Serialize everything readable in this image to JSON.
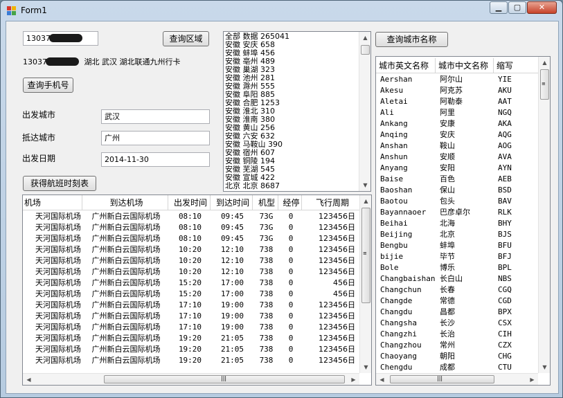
{
  "window": {
    "title": "Form1",
    "minimize_glyph": "▁",
    "maximize_glyph": "▢",
    "close_glyph": "✕",
    "icon_colors": [
      "#d9342b",
      "#f0b400",
      "#3a7bd5",
      "#47a447"
    ]
  },
  "phone": {
    "input_value": "13037",
    "result_prefix": "13037",
    "result_text": "湖北  武汉  湖北联通九州行卡",
    "query_region_button": "查询区域",
    "query_phone_button": "查询手机号"
  },
  "region_list": [
    "全部  数据  265041",
    "安徽  安庆  658",
    "安徽  蚌埠  456",
    "安徽  亳州  489",
    "安徽  巢湖  323",
    "安徽  池州  281",
    "安徽  滁州  555",
    "安徽  阜阳  885",
    "安徽  合肥  1253",
    "安徽  淮北  310",
    "安徽  淮南  380",
    "安徽  黄山  256",
    "安徽  六安  632",
    "安徽  马鞍山  390",
    "安徽  宿州  607",
    "安徽  铜陵  194",
    "安徽  芜湖  545",
    "安徽  宣城  422",
    "北京  北京  8687"
  ],
  "flight_form": {
    "departure_label": "出发城市",
    "departure_value": "武汉",
    "arrival_label": "抵达城市",
    "arrival_value": "广州",
    "date_label": "出发日期",
    "date_value": "2014-11-30",
    "get_schedule_button": "获得航班时刻表"
  },
  "flights": {
    "columns": [
      "机场",
      "到达机场",
      "出发时间",
      "到达时间",
      "机型",
      "经停",
      "飞行周期"
    ],
    "rows": [
      [
        "天河国际机场",
        "广州新白云国际机场",
        "08:10",
        "09:45",
        "73G",
        "0",
        "123456日"
      ],
      [
        "天河国际机场",
        "广州新白云国际机场",
        "08:10",
        "09:45",
        "73G",
        "0",
        "123456日"
      ],
      [
        "天河国际机场",
        "广州新白云国际机场",
        "08:10",
        "09:45",
        "73G",
        "0",
        "123456日"
      ],
      [
        "天河国际机场",
        "广州新白云国际机场",
        "10:20",
        "12:10",
        "738",
        "0",
        "123456日"
      ],
      [
        "天河国际机场",
        "广州新白云国际机场",
        "10:20",
        "12:10",
        "738",
        "0",
        "123456日"
      ],
      [
        "天河国际机场",
        "广州新白云国际机场",
        "10:20",
        "12:10",
        "738",
        "0",
        "123456日"
      ],
      [
        "天河国际机场",
        "广州新白云国际机场",
        "15:20",
        "17:00",
        "738",
        "0",
        "456日"
      ],
      [
        "天河国际机场",
        "广州新白云国际机场",
        "15:20",
        "17:00",
        "738",
        "0",
        "456日"
      ],
      [
        "天河国际机场",
        "广州新白云国际机场",
        "17:10",
        "19:00",
        "738",
        "0",
        "123456日"
      ],
      [
        "天河国际机场",
        "广州新白云国际机场",
        "17:10",
        "19:00",
        "738",
        "0",
        "123456日"
      ],
      [
        "天河国际机场",
        "广州新白云国际机场",
        "17:10",
        "19:00",
        "738",
        "0",
        "123456日"
      ],
      [
        "天河国际机场",
        "广州新白云国际机场",
        "19:20",
        "21:05",
        "738",
        "0",
        "123456日"
      ],
      [
        "天河国际机场",
        "广州新白云国际机场",
        "19:20",
        "21:05",
        "738",
        "0",
        "123456日"
      ],
      [
        "天河国际机场",
        "广州新白云国际机场",
        "19:20",
        "21:05",
        "738",
        "0",
        "123456日"
      ]
    ]
  },
  "cities": {
    "query_button": "查询城市名称",
    "columns": [
      "城市英文名称",
      "城市中文名称",
      "缩写"
    ],
    "rows": [
      [
        "Aershan",
        "阿尔山",
        "YIE"
      ],
      [
        "Akesu",
        "阿克苏",
        "AKU"
      ],
      [
        "Aletai",
        "阿勒泰",
        "AAT"
      ],
      [
        "Ali",
        "阿里",
        "NGQ"
      ],
      [
        "Ankang",
        "安康",
        "AKA"
      ],
      [
        "Anqing",
        "安庆",
        "AQG"
      ],
      [
        "Anshan",
        "鞍山",
        "AOG"
      ],
      [
        "Anshun",
        "安顺",
        "AVA"
      ],
      [
        "Anyang",
        "安阳",
        "AYN"
      ],
      [
        "Baise",
        "百色",
        "AEB"
      ],
      [
        "Baoshan",
        "保山",
        "BSD"
      ],
      [
        "Baotou",
        "包头",
        "BAV"
      ],
      [
        "Bayannaoer",
        "巴彦卓尔",
        "RLK"
      ],
      [
        "Beihai",
        "北海",
        "BHY"
      ],
      [
        "Beijing",
        "北京",
        "BJS"
      ],
      [
        "Bengbu",
        "蚌埠",
        "BFU"
      ],
      [
        "bijie",
        "毕节",
        "BFJ"
      ],
      [
        "Bole",
        "博乐",
        "BPL"
      ],
      [
        "Changbaishan",
        "长白山",
        "NBS"
      ],
      [
        "Changchun",
        "长春",
        "CGQ"
      ],
      [
        "Changde",
        "常德",
        "CGD"
      ],
      [
        "Changdu",
        "昌都",
        "BPX"
      ],
      [
        "Changsha",
        "长沙",
        "CSX"
      ],
      [
        "Changzhi",
        "长治",
        "CIH"
      ],
      [
        "Changzhou",
        "常州",
        "CZX"
      ],
      [
        "Chaoyang",
        "朝阳",
        "CHG"
      ],
      [
        "Chengdu",
        "成都",
        "CTU"
      ]
    ]
  },
  "scroll": {
    "up": "▲",
    "down": "▼",
    "left": "◀",
    "right": "▶",
    "grip": "|||"
  }
}
